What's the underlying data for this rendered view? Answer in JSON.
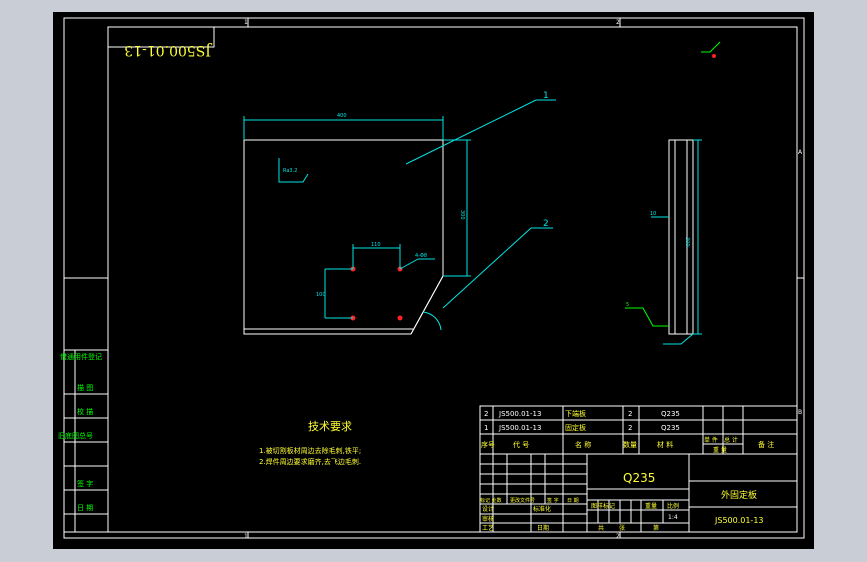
{
  "drawing": {
    "code_stamp": "JS500.01-13",
    "zone_numbers": {
      "top_1": "1",
      "top_2": "2",
      "bottom_1": "1",
      "bottom_2": "2",
      "right_a": "A",
      "right_b": "B"
    },
    "part_callouts": [
      "1",
      "2"
    ],
    "dims": {
      "top_width": "400",
      "right_height": "300",
      "hole_spacing_h": "110",
      "hole_spacing_v": "100",
      "hole_dia": "4-Φ8",
      "surface": "Ra3.2",
      "side_height": "300",
      "side_thick": "10",
      "weld": "5"
    }
  },
  "tech_requirements": {
    "title": "技术要求",
    "lines": [
      "1.被切割板材周边去除毛刺,铁平;",
      "2.焊件周边要求磨齐,去飞边毛刺."
    ]
  },
  "left_strip": {
    "items": [
      "借通用件登记",
      "描 图",
      "校 描",
      "旧底图总号",
      "签 字",
      "日 期"
    ]
  },
  "bom": {
    "rows": [
      {
        "no": "2",
        "code": "JS500.01-13",
        "name": "下端板",
        "qty": "2",
        "material": "Q235"
      },
      {
        "no": "1",
        "code": "JS500.01-13",
        "name": "固定板",
        "qty": "2",
        "material": "Q235"
      }
    ],
    "headers": {
      "no": "序号",
      "code": "代 号",
      "name": "名 称",
      "qty": "数量",
      "material": "材 料",
      "unit_wt": "单 件",
      "total_wt": "总 计",
      "weight": "重 量",
      "note": "备 注"
    }
  },
  "title_block": {
    "material": "Q235",
    "part_name": "外固定板",
    "drawing_no": "JS500.01-13",
    "scale": "1:4",
    "labels": {
      "stage_mark": "图样标记",
      "weight": "重量",
      "scale": "比例",
      "sheets": "共",
      "sheet": "张",
      "sheet_no": "第",
      "rev_rows": [
        "标记 处数",
        "更改文件号",
        "签 字",
        "日 期"
      ],
      "design": "设计",
      "standard": "标准化",
      "check": "审核",
      "process": "工艺",
      "date": "日期"
    }
  }
}
